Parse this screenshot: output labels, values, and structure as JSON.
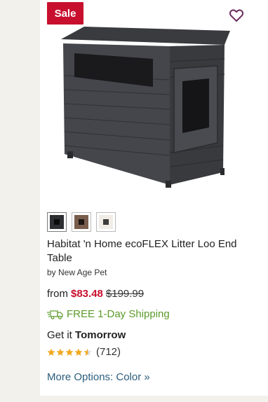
{
  "badge": {
    "label": "Sale",
    "color": "#c8102e"
  },
  "icons": {
    "favorite": "heart-outline-icon",
    "shipping": "truck-icon"
  },
  "swatches": [
    {
      "name": "black",
      "color": "#2e2f33",
      "selected": true
    },
    {
      "name": "brown",
      "color": "#7a5d4d",
      "selected": false
    },
    {
      "name": "white",
      "color": "#f1ede6",
      "selected": false
    }
  ],
  "product": {
    "title": "Habitat 'n Home ecoFLEX Litter Loo End Table",
    "brand": "by New Age Pet"
  },
  "price": {
    "prefix": "from",
    "sale": "$83.48",
    "original": "$199.99"
  },
  "shipping": {
    "label": "FREE 1-Day Shipping",
    "color": "#5c9a2a"
  },
  "delivery": {
    "prefix": "Get it",
    "day": "Tomorrow"
  },
  "rating": {
    "value": 4.5,
    "max": 5,
    "count": "(712)",
    "star_color": "#f2a81d"
  },
  "more_options": "More Options: Color »"
}
